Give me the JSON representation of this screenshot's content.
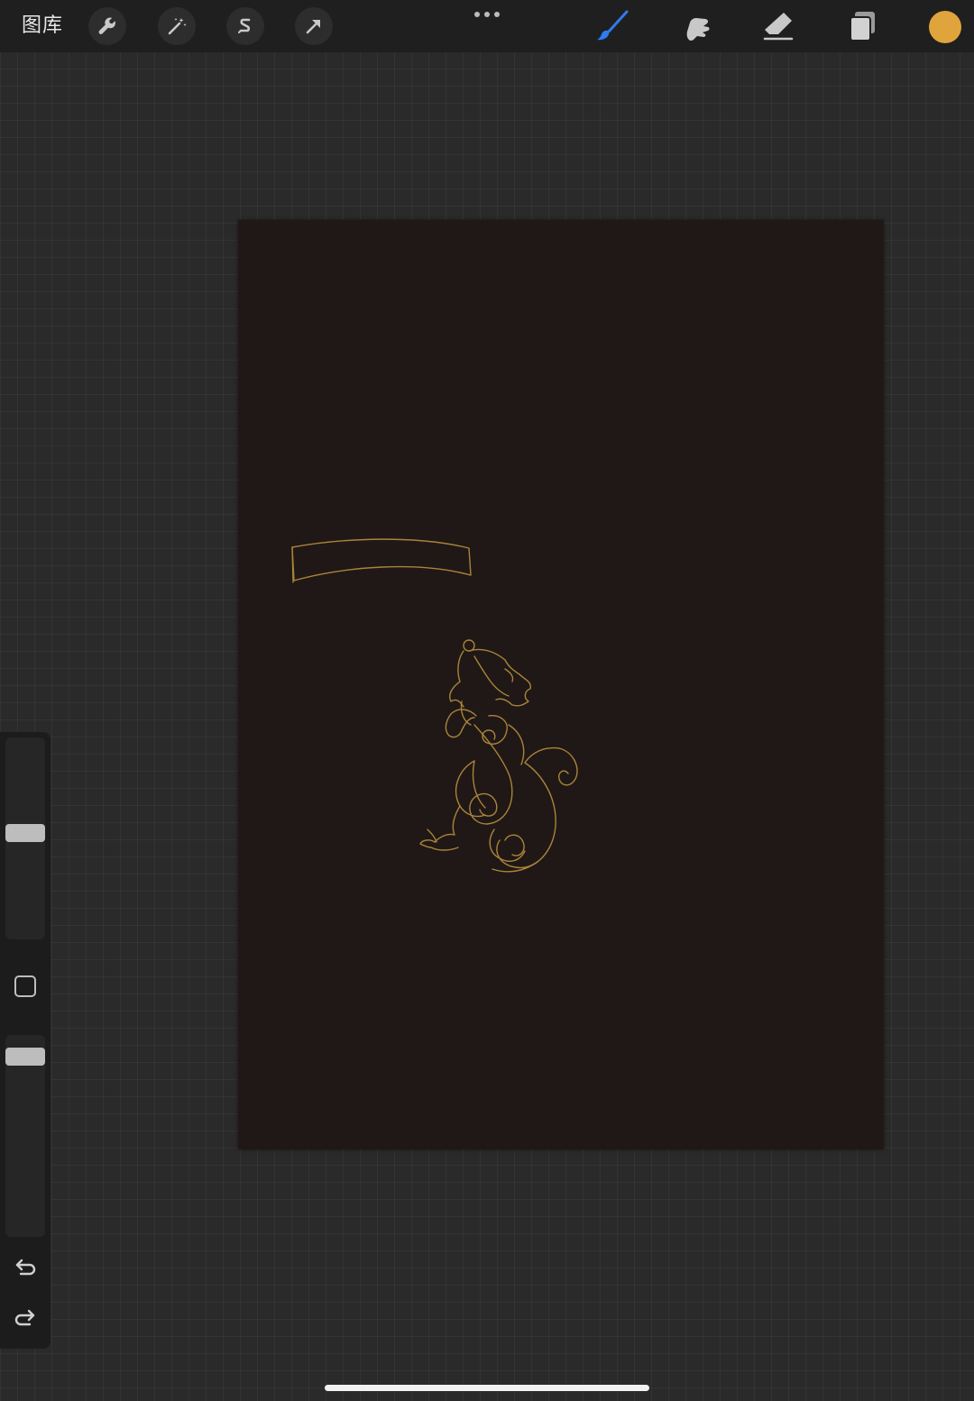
{
  "topbar": {
    "gallery_label": "图库",
    "left_tools": [
      {
        "name": "actions-wrench-icon"
      },
      {
        "name": "adjustments-magic-wand-icon"
      },
      {
        "name": "selection-s-icon"
      },
      {
        "name": "transform-arrow-icon"
      }
    ],
    "more_icon": "ellipsis-icon",
    "right_tools": [
      {
        "name": "brush-icon",
        "active": true
      },
      {
        "name": "smudge-icon",
        "active": false
      },
      {
        "name": "eraser-icon",
        "active": false
      },
      {
        "name": "layers-icon",
        "active": false
      }
    ]
  },
  "colors": {
    "current_color": "#e0a43c",
    "active_tool": "#2f7bf0",
    "canvas_background": "#201816",
    "stroke_color": "#b8903e"
  },
  "sidebar": {
    "brush_size_level": 0.53,
    "opacity_level": 0.93,
    "modify_icon": "square-modify-icon",
    "undo_icon": "undo-arrow-icon",
    "redo_icon": "redo-arrow-icon"
  }
}
